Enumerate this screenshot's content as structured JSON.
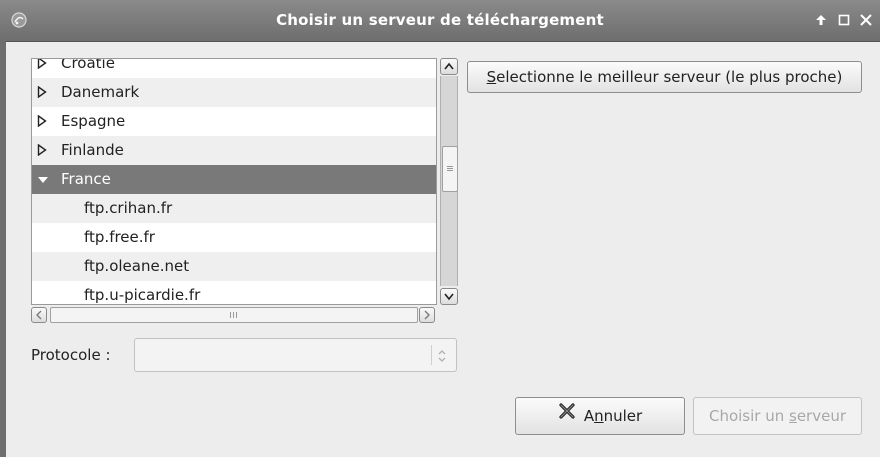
{
  "window": {
    "title": "Choisir un serveur de téléchargement"
  },
  "tree": {
    "rows": [
      {
        "label": "Croatie",
        "kind": "country",
        "expanded": false
      },
      {
        "label": "Danemark",
        "kind": "country",
        "expanded": false
      },
      {
        "label": "Espagne",
        "kind": "country",
        "expanded": false
      },
      {
        "label": "Finlande",
        "kind": "country",
        "expanded": false
      },
      {
        "label": "France",
        "kind": "country",
        "expanded": true,
        "selected": true
      },
      {
        "label": "ftp.crihan.fr",
        "kind": "server"
      },
      {
        "label": "ftp.free.fr",
        "kind": "server"
      },
      {
        "label": "ftp.oleane.net",
        "kind": "server"
      },
      {
        "label": "ftp.u-picardie.fr",
        "kind": "server"
      }
    ]
  },
  "buttons": {
    "select_best": {
      "mnemonic": "S",
      "rest": "electionne le meilleur serveur (le plus proche)"
    },
    "cancel": {
      "before": "A",
      "mnemonic": "n",
      "after": "nuler"
    },
    "choose": {
      "before": "Choisir un ",
      "mnemonic": "s",
      "after": "erveur",
      "enabled": false
    }
  },
  "protocol": {
    "label": "Protocole :",
    "value": ""
  },
  "colors": {
    "titlebar": "#7a7a7a",
    "selection": "#797979",
    "row_alt": "#efefef"
  }
}
